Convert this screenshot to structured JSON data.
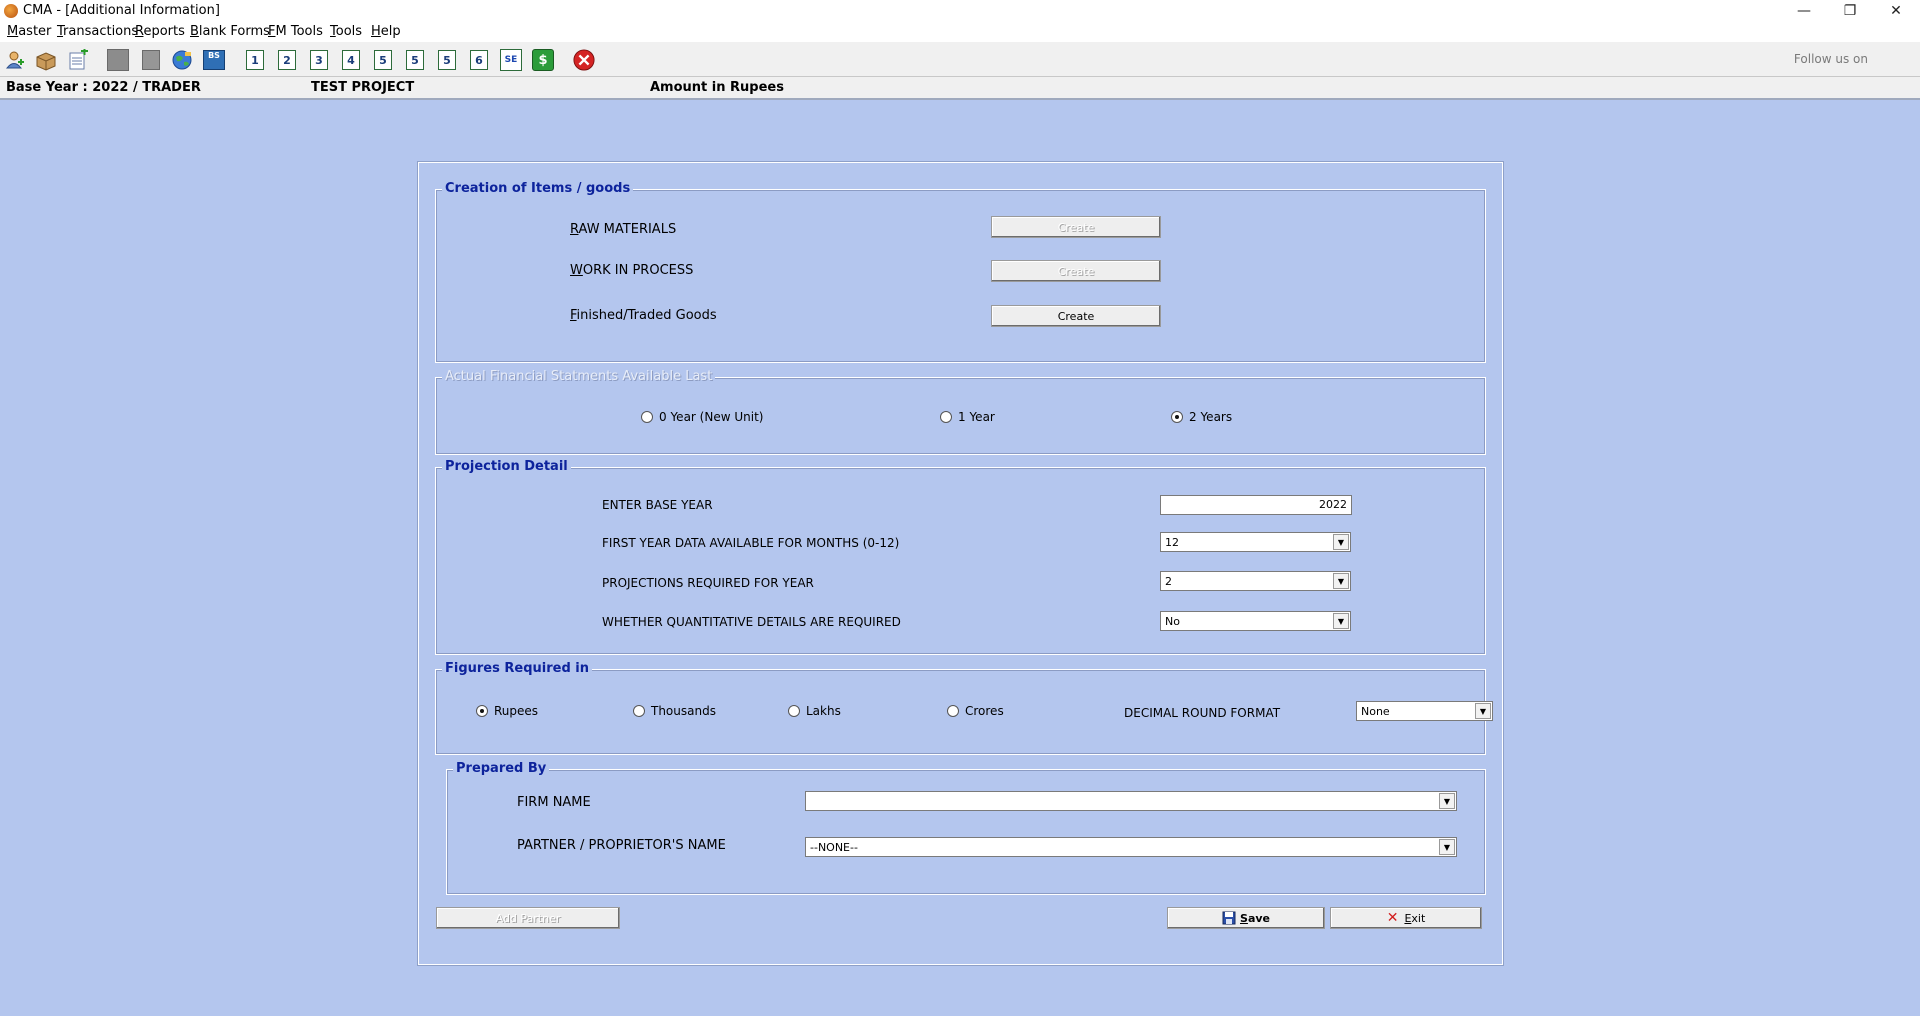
{
  "window": {
    "title": "CMA - [Additional Information]",
    "minimize": "—",
    "restore": "❐",
    "close": "✕"
  },
  "menu": [
    {
      "first": "M",
      "rest": "aster"
    },
    {
      "first": "T",
      "rest": "ransactions"
    },
    {
      "first": "R",
      "rest": "eports"
    },
    {
      "first": "B",
      "rest": "lank Forms"
    },
    {
      "first": "F",
      "rest": "M Tools"
    },
    {
      "first": "T",
      "rest": "ools"
    },
    {
      "first": "H",
      "rest": "elp"
    }
  ],
  "toolbar": {
    "numbers": [
      "1",
      "2",
      "3",
      "4",
      "5",
      "5",
      "5",
      "6"
    ],
    "bs_label": "BS",
    "se_label": "SE",
    "dollar_label": "$",
    "follow_text": "Follow us on"
  },
  "info": {
    "base_year": "Base Year : 2022 / TRADER",
    "project": "TEST PROJECT",
    "amount": "Amount in Rupees"
  },
  "creation": {
    "legend": "Creation of Items / goods",
    "items": [
      {
        "first": "R",
        "rest": "AW MATERIALS",
        "button": "Create",
        "enabled": false
      },
      {
        "first": "W",
        "rest": "ORK IN PROCESS",
        "button": "Create",
        "enabled": false
      },
      {
        "first": "F",
        "rest": "inished/Traded Goods",
        "button": "Create",
        "enabled": true
      }
    ]
  },
  "statements": {
    "legend": "Actual Financial Statments Available Last",
    "options": [
      "0 Year (New Unit)",
      "1 Year",
      "2 Years"
    ],
    "selected": 2
  },
  "projection": {
    "legend": "Projection Detail",
    "base_year_label": "ENTER BASE YEAR",
    "base_year_value": "2022",
    "months_label": "FIRST YEAR DATA AVAILABLE FOR MONTHS (0-12)",
    "months_value": "12",
    "years_label": "PROJECTIONS REQUIRED FOR  YEAR",
    "years_value": "2",
    "quant_label": "WHETHER QUANTITATIVE DETAILS ARE REQUIRED",
    "quant_value": "No"
  },
  "figures": {
    "legend": "Figures Required in",
    "options": [
      "Rupees",
      "Thousands",
      "Lakhs",
      "Crores"
    ],
    "selected": 0,
    "decimal_label": "DECIMAL ROUND FORMAT",
    "decimal_value": "None"
  },
  "prepared": {
    "legend": "Prepared By",
    "firm_label": "FIRM NAME",
    "firm_value": "",
    "partner_label": "PARTNER / PROPRIETOR'S NAME",
    "partner_value": "--NONE--"
  },
  "buttons": {
    "add_partner": "Add Partner",
    "save_first": "S",
    "save_rest": "ave",
    "exit_first": "E",
    "exit_rest": "xit"
  }
}
